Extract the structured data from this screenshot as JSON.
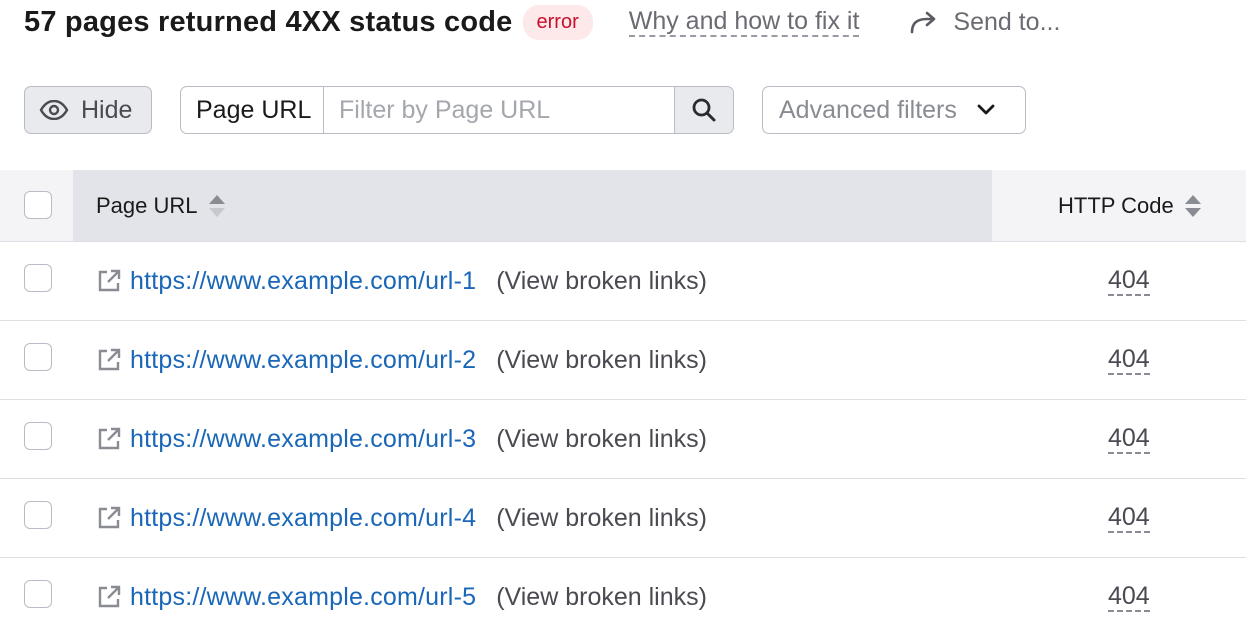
{
  "header": {
    "title": "57 pages returned 4XX status code",
    "badge": "error",
    "why_link": "Why and how to fix it",
    "send_to": "Send to..."
  },
  "toolbar": {
    "hide_label": "Hide",
    "filter_field": "Page URL",
    "filter_placeholder": "Filter by Page URL",
    "filter_value": "",
    "advanced_filters": "Advanced filters"
  },
  "table": {
    "columns": [
      "Page URL",
      "HTTP Code"
    ],
    "rows": [
      {
        "url": "https://www.example.com/url-1",
        "action": "(View broken links)",
        "code": "404"
      },
      {
        "url": "https://www.example.com/url-2",
        "action": "(View broken links)",
        "code": "404"
      },
      {
        "url": "https://www.example.com/url-3",
        "action": "(View broken links)",
        "code": "404"
      },
      {
        "url": "https://www.example.com/url-4",
        "action": "(View broken links)",
        "code": "404"
      },
      {
        "url": "https://www.example.com/url-5",
        "action": "(View broken links)",
        "code": "404"
      }
    ]
  },
  "icons": {
    "send": "share-arrow-icon",
    "hide": "eye-icon",
    "search": "search-icon",
    "advanced": "chevron-down-icon",
    "sort": "sort-icon",
    "external": "external-link-icon"
  },
  "colors": {
    "badge_text": "#c8102e",
    "badge_bg": "#fde8ea",
    "link": "#1a67b8",
    "header_bg": "#e3e4e9"
  }
}
